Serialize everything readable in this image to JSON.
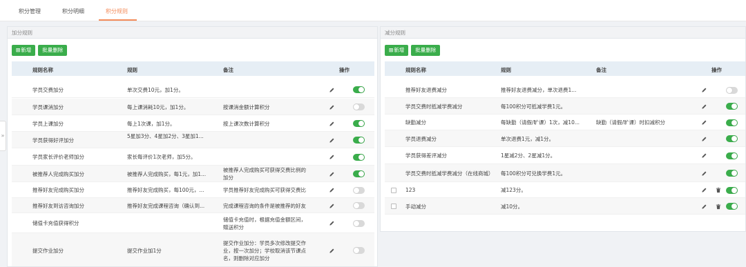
{
  "tabs": [
    {
      "label": "积分管理",
      "active": false
    },
    {
      "label": "积分明细",
      "active": false
    },
    {
      "label": "积分规则",
      "active": true
    }
  ],
  "side_handle": "»",
  "add_rules": {
    "title": "加分规则",
    "buttons": {
      "add": "新增",
      "batch_delete": "批量删除"
    },
    "columns": {
      "name": "规则名称",
      "rule": "规则",
      "note": "备注",
      "action": "操作"
    },
    "rows": [
      {
        "name": "学员交费加分",
        "rule": "单次交费10元，加1分。",
        "note": "",
        "enabled": true
      },
      {
        "name": "学员课消加分",
        "rule": "每上课消耗10元，加1分。",
        "note": "按课消金额计算积分",
        "enabled": false
      },
      {
        "name": "学员上课加分",
        "rule": "每上1次课，加1分。",
        "note": "按上课次数计算积分",
        "enabled": true
      },
      {
        "name": "学员获得好评加分",
        "rule": "5星加3分、4星加2分、3星加1...",
        "note": "",
        "enabled": true
      },
      {
        "name": "学员家长评价老师加分",
        "rule": "家长每评价1次老师，加5分。",
        "note": "",
        "enabled": true
      },
      {
        "name": "被推荐人完成购买加分",
        "rule": "被推荐人完成购买，每1元，加1...",
        "note": "被推荐人完成购买可获得交费比例的加分",
        "enabled": true
      },
      {
        "name": "推荐好友完成购买加分",
        "rule": "推荐好友完成购买，每100元，...",
        "note": "学员推荐好友完成购买可获得交费比例的加分",
        "enabled": false
      },
      {
        "name": "推荐好友到访咨询加分",
        "rule": "推荐好友完成课程咨询（确认到...",
        "note": "完成课程咨询的条件是被推荐的好友有确认到访的记录",
        "enabled": false
      },
      {
        "name": "储值卡充值获得积分",
        "rule": "",
        "note": "储值卡充值时，根据充值金额区间，赠送积分",
        "enabled": false
      },
      {
        "name": "提交作业加分",
        "rule": "提交作业加1分",
        "note": "提交作业加分：学员多次修改提交作业，按一次加分；学校取消该节课点名，则删除对应加分",
        "enabled": false
      }
    ]
  },
  "sub_rules": {
    "title": "减分规则",
    "buttons": {
      "add": "新增",
      "batch_delete": "批量删除"
    },
    "columns": {
      "name": "规则名称",
      "rule": "规则",
      "note": "备注",
      "action": "操作"
    },
    "rows": [
      {
        "name": "推荐好友退费减分",
        "rule": "推荐好友退费减分，单次退费1...",
        "note": "",
        "enabled": false,
        "deletable": false
      },
      {
        "name": "学员交费时抵减学费减分",
        "rule": "每100积分可抵减学费1元。",
        "note": "",
        "enabled": true,
        "deletable": false
      },
      {
        "name": "缺勤减分",
        "rule": "每缺勤（请假/旷课）1次，减10...",
        "note": "缺勤（请假/旷课）时扣减积分",
        "enabled": true,
        "deletable": false
      },
      {
        "name": "学员退费减分",
        "rule": "单次退费1元，减1分。",
        "note": "",
        "enabled": true,
        "deletable": false
      },
      {
        "name": "学员获得差评减分",
        "rule": "1星减2分、2星减1分。",
        "note": "",
        "enabled": true,
        "deletable": false
      },
      {
        "name": "学员交费时抵减学费减分（在线商城）",
        "rule": "每100积分可兑换学费1元。",
        "note": "",
        "enabled": true,
        "deletable": false
      },
      {
        "name": "123",
        "rule": "减123分。",
        "note": "",
        "enabled": true,
        "deletable": true
      },
      {
        "name": "手动减分",
        "rule": "减10分。",
        "note": "",
        "enabled": true,
        "deletable": true
      }
    ]
  },
  "colors": {
    "accent": "#f38b5a",
    "primary_button": "#3aad4b",
    "toggle_on": "#3aad4b",
    "toggle_off": "#d9d9d9",
    "header_bg": "#e6eef5"
  }
}
